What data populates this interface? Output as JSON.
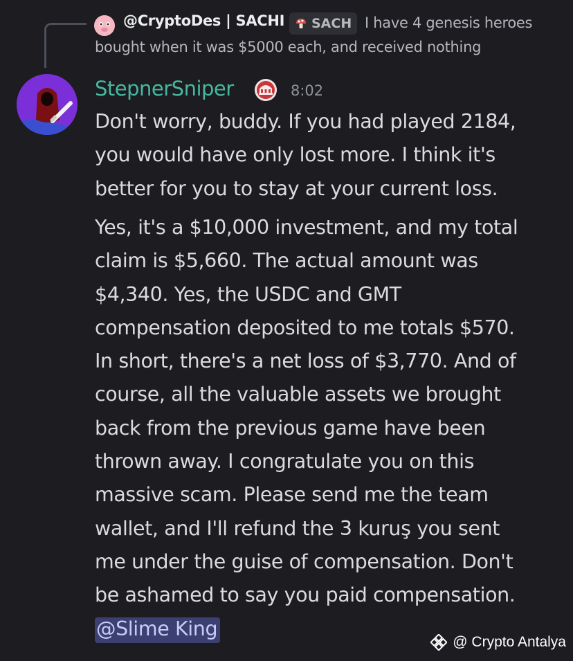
{
  "reply": {
    "author": "@CryptoDes | SACHI",
    "tag": "SACH",
    "text_line1": "I have 4 genesis heroes",
    "text_line2": "bought when it was $5000 each, and received nothing"
  },
  "message": {
    "username": "StepnerSniper",
    "timestamp": "8:02",
    "colors": {
      "username": "#46b8a1",
      "mention_bg": "#3c3f72",
      "background": "#1c1c21"
    },
    "paragraph1": [
      "Don't worry, buddy. If you had played 2184,",
      "you would have only lost more. I think it's",
      "better for you to stay at your current loss."
    ],
    "paragraph2": [
      "Yes, it's a $10,000 investment, and my total",
      "claim is $5,660. The actual amount was",
      "$4,340. Yes, the USDC and GMT",
      "compensation deposited to me totals $570.",
      "In short, there's a net loss of $3,770. And of",
      "course, all the valuable assets we brought",
      "back from the previous game have been",
      "thrown away. I congratulate you on this",
      "massive scam. Please send me the team",
      "wallet, and I'll refund the 3 kuruş you sent",
      "me under the guise of compensation. Don't",
      "be ashamed to say you paid compensation."
    ],
    "mention": "@Slime King"
  },
  "watermark": {
    "text": "@ Crypto Antalya",
    "icon": "binance-diamond-icon"
  }
}
